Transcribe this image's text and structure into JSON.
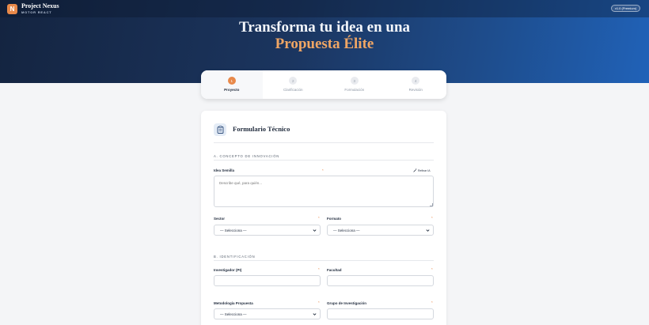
{
  "header": {
    "logo_letter": "N",
    "brand_title": "Project Nexus",
    "brand_subtitle": "MOTOR REACT",
    "version": "v1.0 (Premium)"
  },
  "hero": {
    "line1": "Transforma tu idea en una",
    "line2": "Propuesta Élite"
  },
  "steps": [
    {
      "num": "1",
      "label": "Proyecto",
      "active": true
    },
    {
      "num": "2",
      "label": "Clarificación",
      "active": false
    },
    {
      "num": "3",
      "label": "Formulación",
      "active": false
    },
    {
      "num": "4",
      "label": "Revisión",
      "active": false
    }
  ],
  "form": {
    "title": "Formulario Técnico",
    "icon": "clipboard-icon",
    "section_a": "A. CONCEPTO DE INNOVACIÓN",
    "idea_label": "Idea Semilla",
    "required_mark": "*",
    "refine_label": "Refinar IA",
    "idea_placeholder": "Describe qué, para quién...",
    "sector_label": "Sector",
    "sector_value": "— Selecciona —",
    "formato_label": "Formato",
    "formato_value": "— Selecciona —",
    "section_b": "B. IDENTIFICACIÓN",
    "investigador_label": "Investigador (PI)",
    "facultad_label": "Facultad",
    "metodologia_label": "Metodología Propuesta",
    "metodologia_value": "— Selecciona —",
    "grupo_label": "Grupo de Investigación"
  },
  "colors": {
    "accent": "#e8894a",
    "hero_dark": "#142440",
    "hero_light": "#2062b8"
  }
}
